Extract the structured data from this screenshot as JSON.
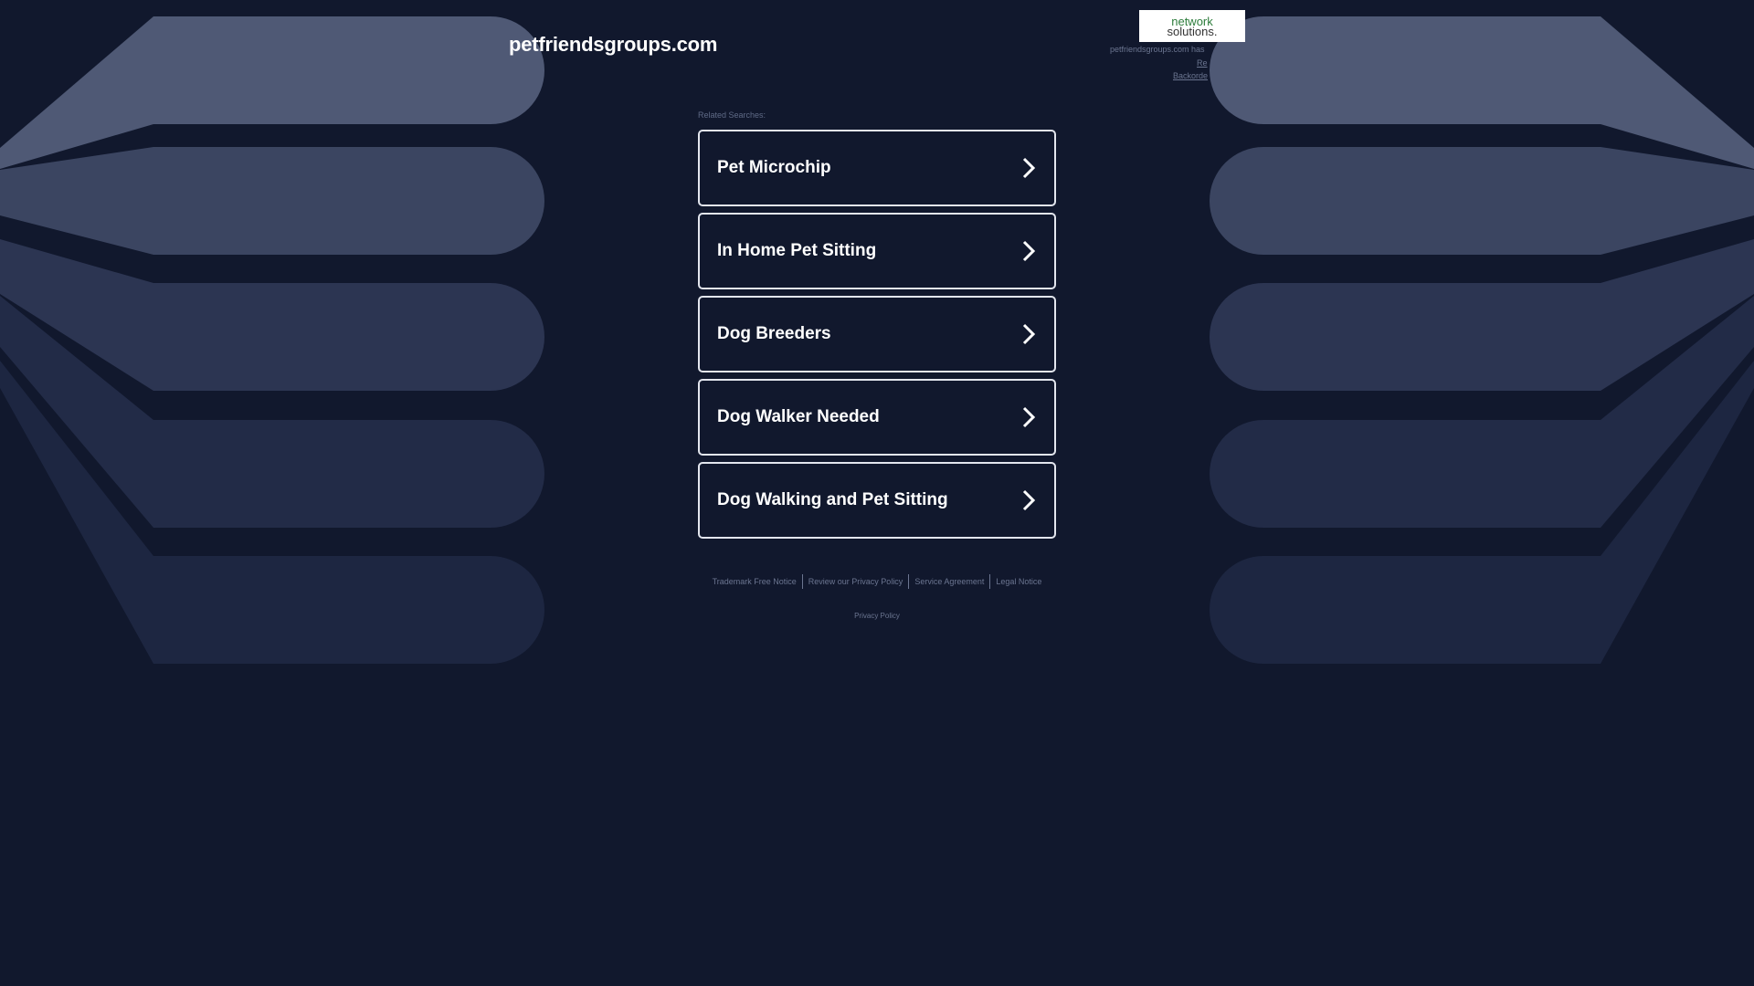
{
  "header": {
    "domain": "petfriendsgroups.com"
  },
  "logo": {
    "line1": "network",
    "line2": "solutions."
  },
  "notice": {
    "text": "petfriendsgroups.com has",
    "link1": "Re",
    "link2": "Backorde"
  },
  "main": {
    "related_label": "Related Searches:",
    "links": [
      "Pet Microchip",
      "In Home Pet Sitting",
      "Dog Breeders",
      "Dog Walker Needed",
      "Dog Walking and Pet Sitting"
    ]
  },
  "footer": {
    "links": [
      "Trademark Free Notice",
      "Review our Privacy Policy",
      "Service Agreement",
      "Legal Notice"
    ],
    "privacy": "Privacy Policy"
  },
  "colors": {
    "background": "#11182d",
    "card_border": "#e3e6ee",
    "logo_green": "#2e7d3c"
  },
  "icons": {
    "chevron": "chevron-right-icon"
  }
}
